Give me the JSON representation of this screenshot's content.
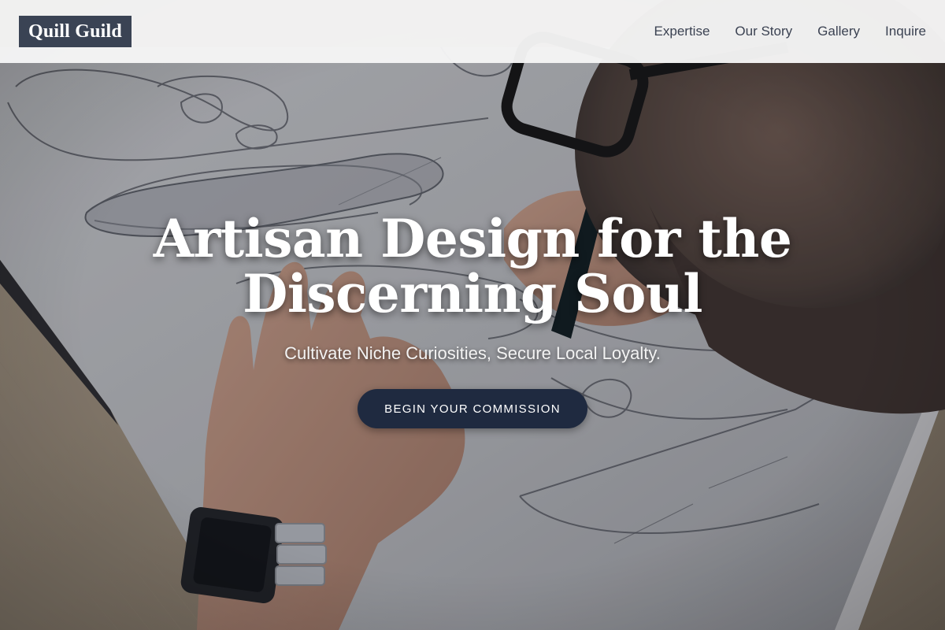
{
  "header": {
    "logo": "Quill Guild",
    "nav": [
      "Expertise",
      "Our Story",
      "Gallery",
      "Inquire"
    ]
  },
  "hero": {
    "title": "Artisan Design for the Discerning Soul",
    "subtitle": "Cultivate Niche Curiosities, Secure Local Loyalty.",
    "cta_label": "BEGIN YOUR COMMISSION"
  },
  "colors": {
    "header_bg": "#f6f6f6",
    "logo_bg": "#3a4354",
    "cta_bg": "#1f2a40",
    "nav_text": "#3b4252"
  }
}
